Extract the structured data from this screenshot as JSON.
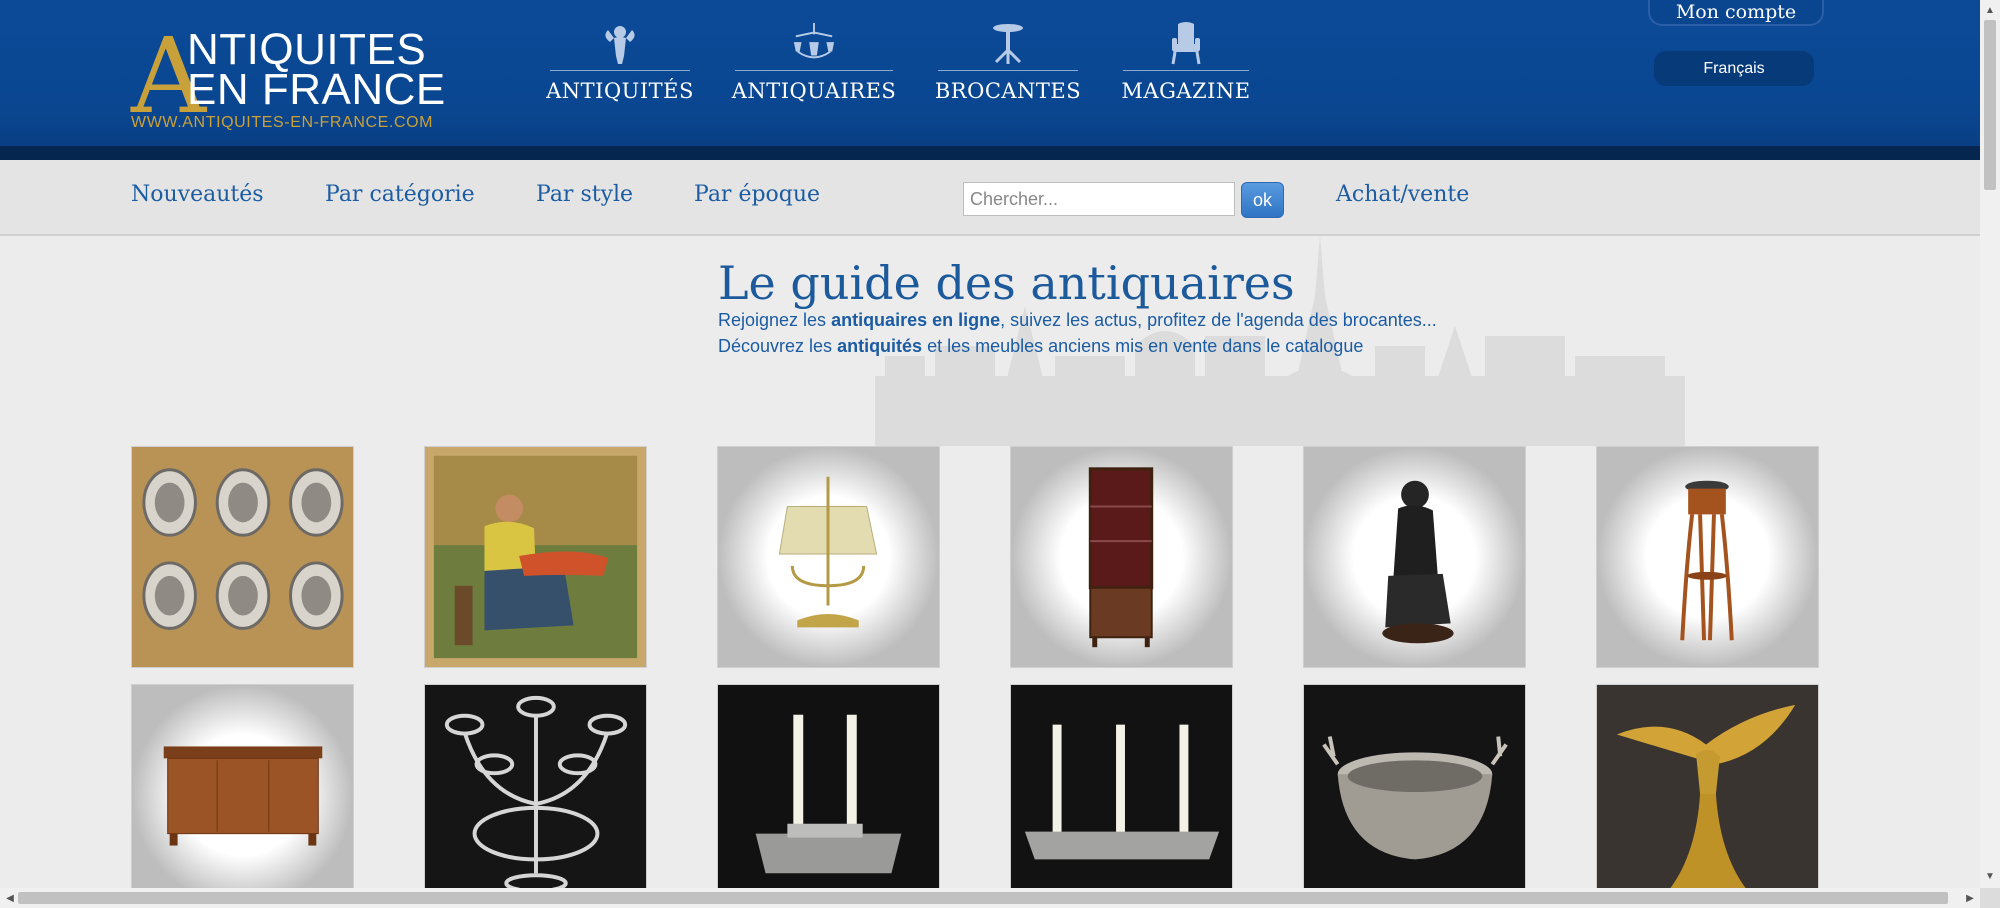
{
  "header": {
    "logo_initial": "A",
    "logo_line1": "NTIQUITES",
    "logo_line2": "EN FRANCE",
    "logo_url": "WWW.ANTIQUITES-EN-FRANCE.COM",
    "nav": [
      {
        "label": "ANTIQUITÉS",
        "icon": "cherub-icon"
      },
      {
        "label": "ANTIQUAIRES",
        "icon": "chandelier-icon"
      },
      {
        "label": "BROCANTES",
        "icon": "pedestal-table-icon"
      },
      {
        "label": "MAGAZINE",
        "icon": "armchair-icon"
      }
    ],
    "account_label": "Mon compte",
    "language_label": "Français"
  },
  "subnav": {
    "links": [
      "Nouveautés",
      "Par catégorie",
      "Par style",
      "Par époque"
    ],
    "search_placeholder": "Chercher...",
    "search_button": "ok",
    "achat_vente": "Achat/vente"
  },
  "main": {
    "title": "Le guide des antiquaires",
    "intro1_pre": "Rejoignez les ",
    "intro1_bold": "antiquaires en ligne",
    "intro1_post": ", suivez les actus, profitez de l'agenda des brocantes...",
    "intro2_pre": "Découvrez les ",
    "intro2_bold": "antiquités",
    "intro2_post": " et les meubles anciens mis en vente dans le catalogue"
  },
  "products": [
    {
      "icon": "silver-plates-image",
      "bg": "#b89355"
    },
    {
      "icon": "painting-seated-woman-image",
      "bg": "#c7a86a"
    },
    {
      "icon": "bouillotte-lamp-image",
      "bg": "#f2f2f2"
    },
    {
      "icon": "vitrine-cabinet-image",
      "bg": "#f2f2f2"
    },
    {
      "icon": "bronze-statue-image",
      "bg": "#f2f2f2"
    },
    {
      "icon": "pedestal-side-table-image",
      "bg": "#f2f2f2"
    },
    {
      "icon": "walnut-sideboard-image",
      "bg": "#f2f2f2"
    },
    {
      "icon": "crystal-candelabra-image",
      "bg": "#151515"
    },
    {
      "icon": "two-candle-tray-image",
      "bg": "#111111"
    },
    {
      "icon": "three-candle-tray-image",
      "bg": "#121212"
    },
    {
      "icon": "stag-handle-bowl-image",
      "bg": "#141414"
    },
    {
      "icon": "gilt-eagle-statue-image",
      "bg": "#3a3430"
    }
  ],
  "colors": {
    "header_blue": "#0a4690",
    "gold": "#c9a13a",
    "link_blue": "#1b5ca3"
  }
}
